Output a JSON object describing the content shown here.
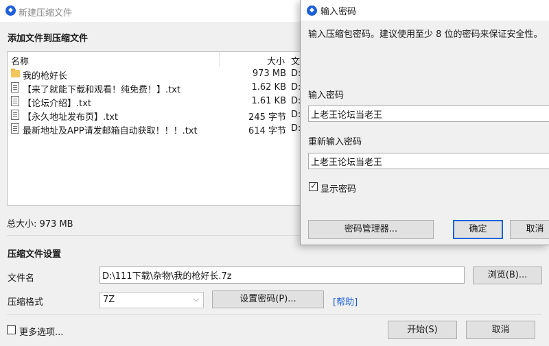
{
  "colors": {
    "accent": "#1d5fd6",
    "link": "#1a5fd0",
    "default_button_border": "#0a64d8"
  },
  "main_window": {
    "title": "新建压缩文件",
    "logo_icon": "app-logo-icon",
    "add_files_header": "添加文件到压缩文件",
    "file_list": {
      "columns": {
        "name": "名称",
        "size": "大小",
        "type": "文"
      },
      "rows": [
        {
          "icon": "folder-icon",
          "name": "我的枪好长",
          "size": "973 MB",
          "type": "D:"
        },
        {
          "icon": "text-file-icon",
          "name": "【来了就能下载和观看！纯免费！】.txt",
          "size": "1.62 KB",
          "type": "D:"
        },
        {
          "icon": "text-file-icon",
          "name": "【论坛介绍】.txt",
          "size": "1.61 KB",
          "type": "D:"
        },
        {
          "icon": "text-file-icon",
          "name": "【永久地址发布页】.txt",
          "size": "245 字节",
          "type": "D:"
        },
        {
          "icon": "text-file-icon",
          "name": "最新地址及APP请发邮箱自动获取！！！.txt",
          "size": "614 字节",
          "type": "D:"
        }
      ]
    },
    "total_size": "总大小: 973 MB",
    "compress_settings_header": "压缩文件设置",
    "filename_label": "文件名",
    "filename_value": "D:\\111下载\\杂物\\我的枪好长.7z",
    "browse_button": "浏览(B)...",
    "format_label": "压缩格式",
    "format_value": "7Z",
    "set_password_button": "设置密码(P)...",
    "help_link": "[帮助]",
    "more_options_label": "更多选项...",
    "start_button": "开始(S)",
    "cancel_button": "取消"
  },
  "password_dialog": {
    "title": "输入密码",
    "hint": "输入压缩包密码。建议使用至少 8 位的密码来保证安全性。",
    "password_label": "输入密码",
    "password_value": "上老王论坛当老王",
    "confirm_label": "重新输入密码",
    "confirm_value": "上老王论坛当老王",
    "show_password_label": "显示密码",
    "show_password_checked": "✓",
    "password_manager_button": "密码管理器...",
    "ok_button": "确定",
    "cancel_button": "取消"
  }
}
